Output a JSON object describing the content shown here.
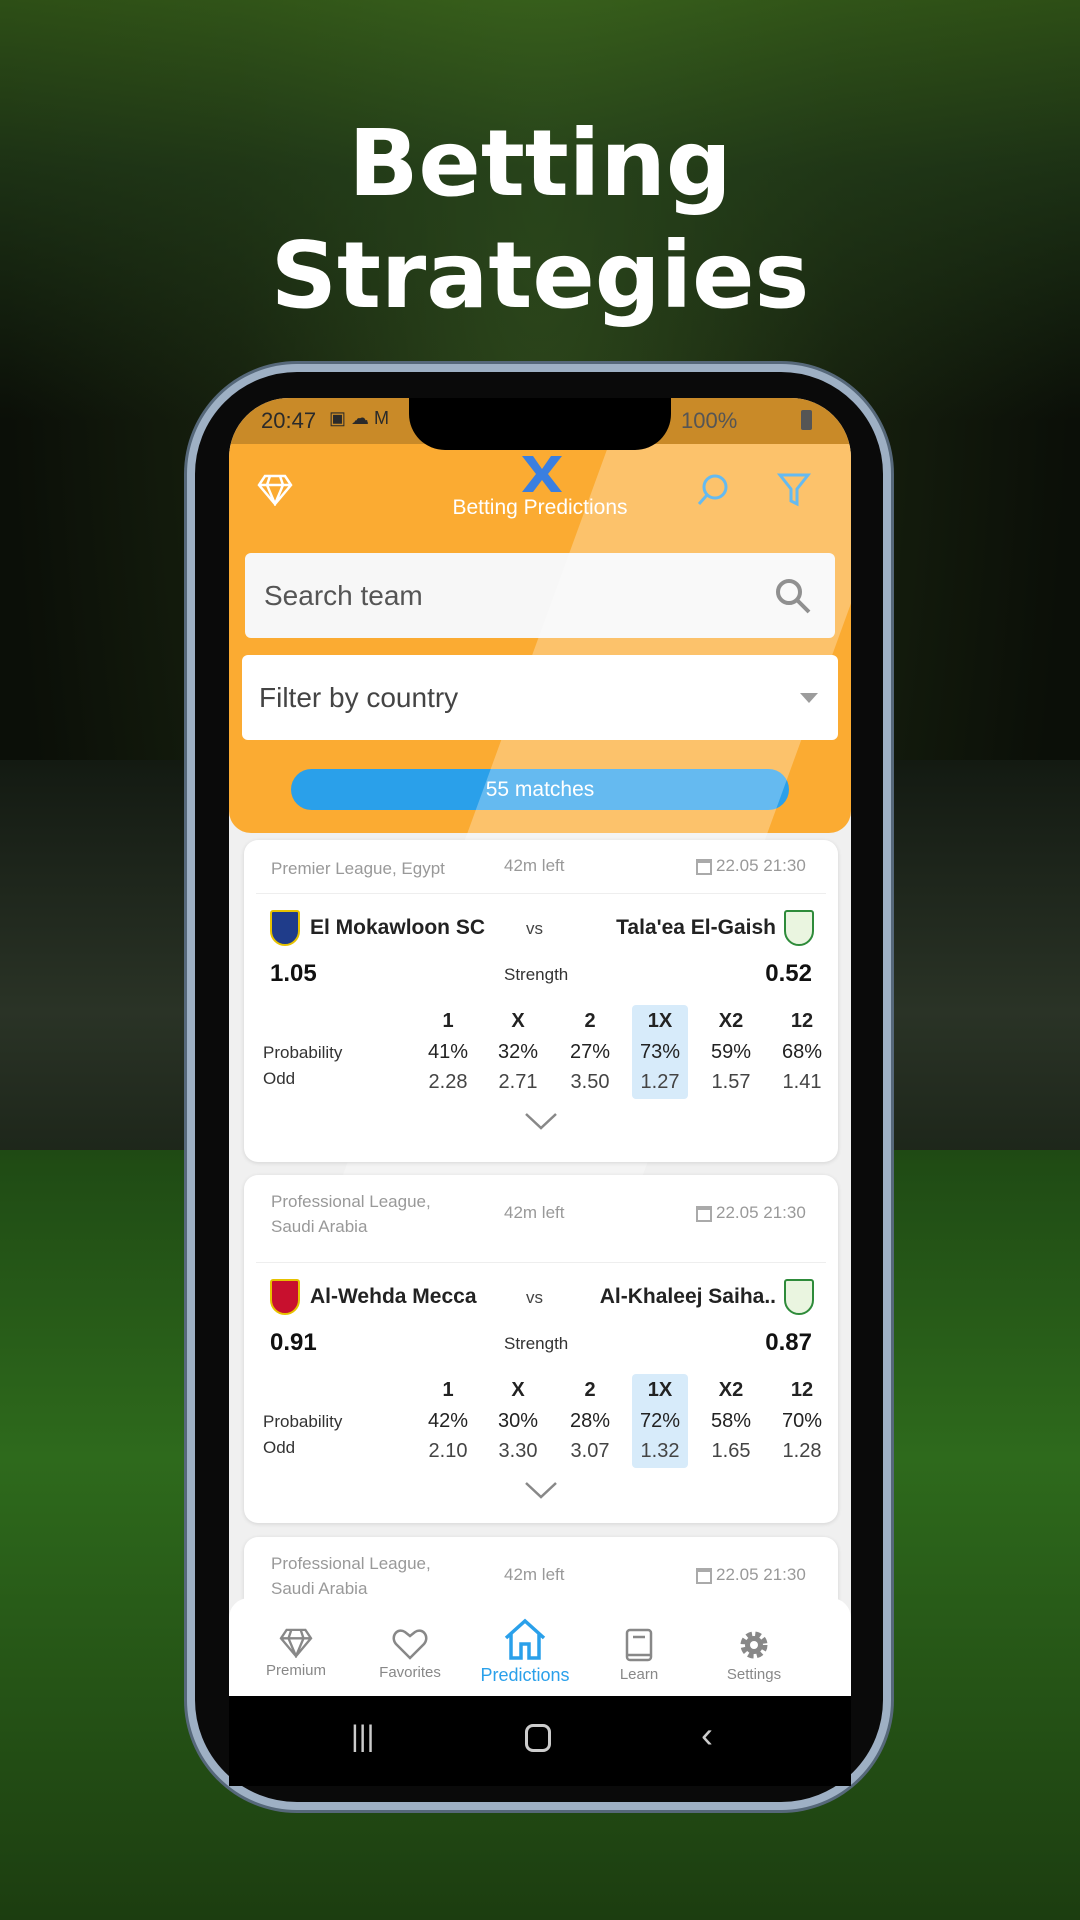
{
  "headline": [
    "Betting",
    "Strategies"
  ],
  "status_bar": {
    "time": "20:47",
    "battery": "100%"
  },
  "app": {
    "title": "Betting Predictions",
    "accent": "#fbab32",
    "blue": "#2aa0ea"
  },
  "search": {
    "placeholder": "Search team"
  },
  "filter": {
    "placeholder": "Filter by country"
  },
  "matches_count": "55 matches",
  "columns": [
    "1",
    "X",
    "2",
    "1X",
    "X2",
    "12"
  ],
  "row_labels": {
    "probability": "Probability",
    "odd": "Odd",
    "strength": "Strength",
    "vs": "vs"
  },
  "matches": [
    {
      "league": "Premier League, Egypt",
      "time_left": "42m left",
      "date": "22.05 21:30",
      "home": "El Mokawloon SC",
      "away": "Tala'ea El-Gaish",
      "home_strength": "1.05",
      "away_strength": "0.52",
      "probability": [
        "41%",
        "32%",
        "27%",
        "73%",
        "59%",
        "68%"
      ],
      "odds": [
        "2.28",
        "2.71",
        "3.50",
        "1.27",
        "1.57",
        "1.41"
      ],
      "highlight": "1X"
    },
    {
      "league": "Professional League, Saudi Arabia",
      "time_left": "42m left",
      "date": "22.05 21:30",
      "home": "Al-Wehda Mecca",
      "away": "Al-Khaleej Saiha..",
      "home_strength": "0.91",
      "away_strength": "0.87",
      "probability": [
        "42%",
        "30%",
        "28%",
        "72%",
        "58%",
        "70%"
      ],
      "odds": [
        "2.10",
        "3.30",
        "3.07",
        "1.32",
        "1.65",
        "1.28"
      ],
      "highlight": "1X"
    },
    {
      "league": "Professional League, Saudi Arabia",
      "time_left": "42m left",
      "date": "22.05 21:30"
    }
  ],
  "nav": [
    {
      "label": "Premium",
      "icon": "diamond-icon"
    },
    {
      "label": "Favorites",
      "icon": "heart-icon"
    },
    {
      "label": "Predictions",
      "icon": "home-icon",
      "active": true
    },
    {
      "label": "Learn",
      "icon": "book-icon"
    },
    {
      "label": "Settings",
      "icon": "gear-icon"
    }
  ]
}
